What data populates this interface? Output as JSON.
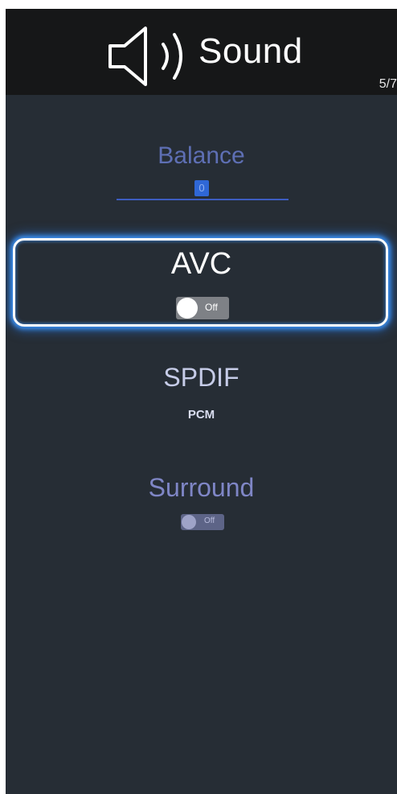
{
  "header": {
    "title": "Sound",
    "icon": "speaker-icon",
    "page_indicator": "5/7"
  },
  "items": {
    "balance": {
      "label": "Balance",
      "value": "0"
    },
    "avc": {
      "label": "AVC",
      "toggle_state": "Off",
      "focused": true
    },
    "spdif": {
      "label": "SPDIF",
      "value": "PCM"
    },
    "surround": {
      "label": "Surround",
      "toggle_state": "Off"
    }
  },
  "colors": {
    "background": "#262d35",
    "header": "#161718",
    "focus_glow": "#3a8ff0",
    "slider": "#3d5cc0"
  }
}
